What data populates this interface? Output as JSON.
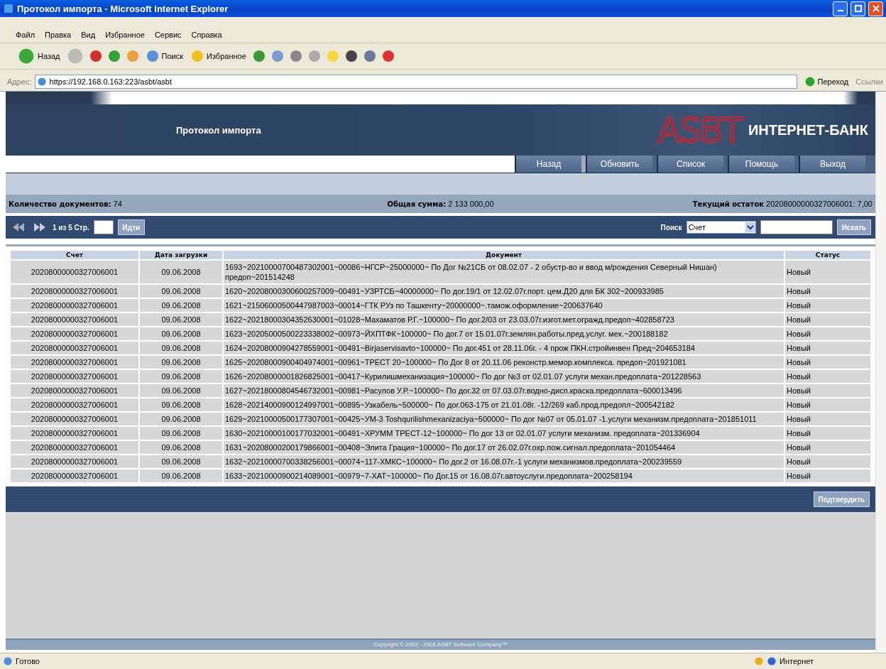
{
  "window": {
    "title": "Протокол импорта - Microsoft Internet Explorer"
  },
  "menu": [
    "Файл",
    "Правка",
    "Вид",
    "Избранное",
    "Сервис",
    "Справка"
  ],
  "toolbar": {
    "back": "Назад",
    "search": "Поиск",
    "favorites": "Избранное"
  },
  "address": {
    "label": "Адрес:",
    "url": "https://192.168.0.163:223/asbt/asbt",
    "go": "Переход",
    "links": "Ссылки"
  },
  "page": {
    "title": "Протокол импорта",
    "logo": "ASBT",
    "brand": "ИНТЕРНЕТ-БАНК",
    "nav": [
      "Назад",
      "Обновить",
      "Список",
      "Помощь",
      "Выход"
    ],
    "info": [
      {
        "label": "Количество документов:",
        "value": "74"
      },
      {
        "label": "Общая сумма:",
        "value": "2 133 000,00"
      },
      {
        "label": "Текущий остаток",
        "value": "20208000000327006001: 7,00"
      }
    ],
    "pager": {
      "page_info": "1 из 5 Стр.",
      "go": "Идти"
    },
    "search": {
      "label": "Поиск",
      "field": "Счет",
      "button": "Искать"
    },
    "table": {
      "columns": [
        "Счет",
        "Дата загрузки",
        "Документ",
        "Статус"
      ],
      "rows": [
        [
          "20208000000327006001",
          "09.06.2008",
          "1693~20210000700487302001~00086~НГСР~25000000~ По Дог №21СБ от 08.02.07 - 2 обустр-во и ввод м/рождения Северный Нишан) предоп~201514248",
          "Новый"
        ],
        [
          "20208000000327006001",
          "09.06.2008",
          "1620~20208000300600257009~00491~УЗРТСБ~40000000~ По дог.19/1 от 12.02.07г.порт. цем.Д20 для БК 302~200933985",
          "Новый"
        ],
        [
          "20208000000327006001",
          "09.06.2008",
          "1621~21506000500447987003~00014~ГТК РУз по Ташкенту~20000000~.тамож.оформление~200637640",
          "Новый"
        ],
        [
          "20208000000327006001",
          "09.06.2008",
          "1622~20218000304352630001~01028~Махаматов Р.Г.~100000~ По дог.2/03 от 23.03.07г.изгот.мет.огражд.предоп~402858723",
          "Новый"
        ],
        [
          "20208000000327006001",
          "09.06.2008",
          "1623~20205000500223338002~00973~ЙХПТФК~100000~ По дог.7 от 15.01.07г.землян.работы.пред.услуг. мех.~200188182",
          "Новый"
        ],
        [
          "20208000000327006001",
          "09.06.2008",
          "1624~20208000904278559001~00491~Birjaservisavto~100000~ По дог.451 от 28.11.06г. - 4 прож ПКН.стройинвен Пред~204653184",
          "Новый"
        ],
        [
          "20208000000327006001",
          "09.06.2008",
          "1625~20208000900404974001~00961~ТРЕСТ 20~100000~ По Дог 8 от 20.11.06 реконстр.мемор.комплекса. предоп~201921081",
          "Новый"
        ],
        [
          "20208000000327006001",
          "09.06.2008",
          "1626~20208000001826825001~00417~Курилишмеханизация~100000~ По дог №3 от 02.01.07 услуги механ.предоплата~201228563",
          "Новый"
        ],
        [
          "20208000000327006001",
          "09.06.2008",
          "1627~20218000804546732001~00981~Расулов У.Р.~100000~ По дог.32 от 07.03.07г.водно-дисп.краска.предоплата~600013496",
          "Новый"
        ],
        [
          "20208000000327006001",
          "09.06.2008",
          "1628~20214000900124997001~00895~Узкабель~500000~ По дог.063-175 от 21.01.08г. -12/269 каб.прод.предопл~200542182",
          "Новый"
        ],
        [
          "20208000000327006001",
          "09.06.2008",
          "1629~20210000500177307001~00425~УМ-3 Toshqurilishmexanizaciya~500000~ По дог №07 от 05.01.07 -1.услуги механизм.предоплата~201851011",
          "Новый"
        ],
        [
          "20208000000327006001",
          "09.06.2008",
          "1630~20210000100177032001~00491~ХРУММ ТРЕСТ-12~100000~ По дог 13 от 02.01.07 услуги механизм. предоплата~201336904",
          "Новый"
        ],
        [
          "20208000000327006001",
          "09.06.2008",
          "1631~20208000200179866001~00408~Элита Грация~100000~ По дог.17 от 26.02.07г.охр.пож.сигнал.предоплата~201054464",
          "Новый"
        ],
        [
          "20208000000327006001",
          "09.06.2008",
          "1632~20210000700338256001~00074~117-ХМКС~100000~ По дог.2 от 16.08.07г.-1 услуги механизмов.предоплата~200239559",
          "Новый"
        ],
        [
          "20208000000327006001",
          "09.06.2008",
          "1633~20210000900214089001~00979~7-ХАТ~100000~ По Дог.15 от 16.08.07г.автоуслуги.предоплата~200258194",
          "Новый"
        ]
      ]
    },
    "confirm": "Подтвердить",
    "copyright": "Copyright © 2002 - 2008 ASBT Software Company™"
  },
  "status": {
    "text": "Готово",
    "zone": "Интернет"
  }
}
